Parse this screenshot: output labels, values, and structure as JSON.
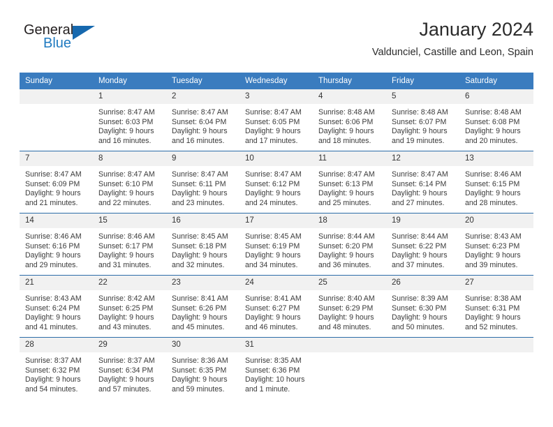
{
  "brand": {
    "name_part1": "General",
    "name_part2": "Blue",
    "accent_color": "#1668ae"
  },
  "header": {
    "title": "January 2024",
    "location": "Valdunciel, Castille and Leon, Spain"
  },
  "theme": {
    "header_row_color": "#3a7cbf",
    "daynum_band_color": "#f1f1f1",
    "week_divider_color": "#2b6ca8"
  },
  "weekday_headers": [
    "Sunday",
    "Monday",
    "Tuesday",
    "Wednesday",
    "Thursday",
    "Friday",
    "Saturday"
  ],
  "weeks": [
    [
      {
        "day": "",
        "sunrise": "",
        "sunset": "",
        "daylight_line1": "",
        "daylight_line2": ""
      },
      {
        "day": "1",
        "sunrise": "Sunrise: 8:47 AM",
        "sunset": "Sunset: 6:03 PM",
        "daylight_line1": "Daylight: 9 hours",
        "daylight_line2": "and 16 minutes."
      },
      {
        "day": "2",
        "sunrise": "Sunrise: 8:47 AM",
        "sunset": "Sunset: 6:04 PM",
        "daylight_line1": "Daylight: 9 hours",
        "daylight_line2": "and 16 minutes."
      },
      {
        "day": "3",
        "sunrise": "Sunrise: 8:47 AM",
        "sunset": "Sunset: 6:05 PM",
        "daylight_line1": "Daylight: 9 hours",
        "daylight_line2": "and 17 minutes."
      },
      {
        "day": "4",
        "sunrise": "Sunrise: 8:48 AM",
        "sunset": "Sunset: 6:06 PM",
        "daylight_line1": "Daylight: 9 hours",
        "daylight_line2": "and 18 minutes."
      },
      {
        "day": "5",
        "sunrise": "Sunrise: 8:48 AM",
        "sunset": "Sunset: 6:07 PM",
        "daylight_line1": "Daylight: 9 hours",
        "daylight_line2": "and 19 minutes."
      },
      {
        "day": "6",
        "sunrise": "Sunrise: 8:48 AM",
        "sunset": "Sunset: 6:08 PM",
        "daylight_line1": "Daylight: 9 hours",
        "daylight_line2": "and 20 minutes."
      }
    ],
    [
      {
        "day": "7",
        "sunrise": "Sunrise: 8:47 AM",
        "sunset": "Sunset: 6:09 PM",
        "daylight_line1": "Daylight: 9 hours",
        "daylight_line2": "and 21 minutes."
      },
      {
        "day": "8",
        "sunrise": "Sunrise: 8:47 AM",
        "sunset": "Sunset: 6:10 PM",
        "daylight_line1": "Daylight: 9 hours",
        "daylight_line2": "and 22 minutes."
      },
      {
        "day": "9",
        "sunrise": "Sunrise: 8:47 AM",
        "sunset": "Sunset: 6:11 PM",
        "daylight_line1": "Daylight: 9 hours",
        "daylight_line2": "and 23 minutes."
      },
      {
        "day": "10",
        "sunrise": "Sunrise: 8:47 AM",
        "sunset": "Sunset: 6:12 PM",
        "daylight_line1": "Daylight: 9 hours",
        "daylight_line2": "and 24 minutes."
      },
      {
        "day": "11",
        "sunrise": "Sunrise: 8:47 AM",
        "sunset": "Sunset: 6:13 PM",
        "daylight_line1": "Daylight: 9 hours",
        "daylight_line2": "and 25 minutes."
      },
      {
        "day": "12",
        "sunrise": "Sunrise: 8:47 AM",
        "sunset": "Sunset: 6:14 PM",
        "daylight_line1": "Daylight: 9 hours",
        "daylight_line2": "and 27 minutes."
      },
      {
        "day": "13",
        "sunrise": "Sunrise: 8:46 AM",
        "sunset": "Sunset: 6:15 PM",
        "daylight_line1": "Daylight: 9 hours",
        "daylight_line2": "and 28 minutes."
      }
    ],
    [
      {
        "day": "14",
        "sunrise": "Sunrise: 8:46 AM",
        "sunset": "Sunset: 6:16 PM",
        "daylight_line1": "Daylight: 9 hours",
        "daylight_line2": "and 29 minutes."
      },
      {
        "day": "15",
        "sunrise": "Sunrise: 8:46 AM",
        "sunset": "Sunset: 6:17 PM",
        "daylight_line1": "Daylight: 9 hours",
        "daylight_line2": "and 31 minutes."
      },
      {
        "day": "16",
        "sunrise": "Sunrise: 8:45 AM",
        "sunset": "Sunset: 6:18 PM",
        "daylight_line1": "Daylight: 9 hours",
        "daylight_line2": "and 32 minutes."
      },
      {
        "day": "17",
        "sunrise": "Sunrise: 8:45 AM",
        "sunset": "Sunset: 6:19 PM",
        "daylight_line1": "Daylight: 9 hours",
        "daylight_line2": "and 34 minutes."
      },
      {
        "day": "18",
        "sunrise": "Sunrise: 8:44 AM",
        "sunset": "Sunset: 6:20 PM",
        "daylight_line1": "Daylight: 9 hours",
        "daylight_line2": "and 36 minutes."
      },
      {
        "day": "19",
        "sunrise": "Sunrise: 8:44 AM",
        "sunset": "Sunset: 6:22 PM",
        "daylight_line1": "Daylight: 9 hours",
        "daylight_line2": "and 37 minutes."
      },
      {
        "day": "20",
        "sunrise": "Sunrise: 8:43 AM",
        "sunset": "Sunset: 6:23 PM",
        "daylight_line1": "Daylight: 9 hours",
        "daylight_line2": "and 39 minutes."
      }
    ],
    [
      {
        "day": "21",
        "sunrise": "Sunrise: 8:43 AM",
        "sunset": "Sunset: 6:24 PM",
        "daylight_line1": "Daylight: 9 hours",
        "daylight_line2": "and 41 minutes."
      },
      {
        "day": "22",
        "sunrise": "Sunrise: 8:42 AM",
        "sunset": "Sunset: 6:25 PM",
        "daylight_line1": "Daylight: 9 hours",
        "daylight_line2": "and 43 minutes."
      },
      {
        "day": "23",
        "sunrise": "Sunrise: 8:41 AM",
        "sunset": "Sunset: 6:26 PM",
        "daylight_line1": "Daylight: 9 hours",
        "daylight_line2": "and 45 minutes."
      },
      {
        "day": "24",
        "sunrise": "Sunrise: 8:41 AM",
        "sunset": "Sunset: 6:27 PM",
        "daylight_line1": "Daylight: 9 hours",
        "daylight_line2": "and 46 minutes."
      },
      {
        "day": "25",
        "sunrise": "Sunrise: 8:40 AM",
        "sunset": "Sunset: 6:29 PM",
        "daylight_line1": "Daylight: 9 hours",
        "daylight_line2": "and 48 minutes."
      },
      {
        "day": "26",
        "sunrise": "Sunrise: 8:39 AM",
        "sunset": "Sunset: 6:30 PM",
        "daylight_line1": "Daylight: 9 hours",
        "daylight_line2": "and 50 minutes."
      },
      {
        "day": "27",
        "sunrise": "Sunrise: 8:38 AM",
        "sunset": "Sunset: 6:31 PM",
        "daylight_line1": "Daylight: 9 hours",
        "daylight_line2": "and 52 minutes."
      }
    ],
    [
      {
        "day": "28",
        "sunrise": "Sunrise: 8:37 AM",
        "sunset": "Sunset: 6:32 PM",
        "daylight_line1": "Daylight: 9 hours",
        "daylight_line2": "and 54 minutes."
      },
      {
        "day": "29",
        "sunrise": "Sunrise: 8:37 AM",
        "sunset": "Sunset: 6:34 PM",
        "daylight_line1": "Daylight: 9 hours",
        "daylight_line2": "and 57 minutes."
      },
      {
        "day": "30",
        "sunrise": "Sunrise: 8:36 AM",
        "sunset": "Sunset: 6:35 PM",
        "daylight_line1": "Daylight: 9 hours",
        "daylight_line2": "and 59 minutes."
      },
      {
        "day": "31",
        "sunrise": "Sunrise: 8:35 AM",
        "sunset": "Sunset: 6:36 PM",
        "daylight_line1": "Daylight: 10 hours",
        "daylight_line2": "and 1 minute."
      },
      {
        "day": "",
        "sunrise": "",
        "sunset": "",
        "daylight_line1": "",
        "daylight_line2": ""
      },
      {
        "day": "",
        "sunrise": "",
        "sunset": "",
        "daylight_line1": "",
        "daylight_line2": ""
      },
      {
        "day": "",
        "sunrise": "",
        "sunset": "",
        "daylight_line1": "",
        "daylight_line2": ""
      }
    ]
  ]
}
